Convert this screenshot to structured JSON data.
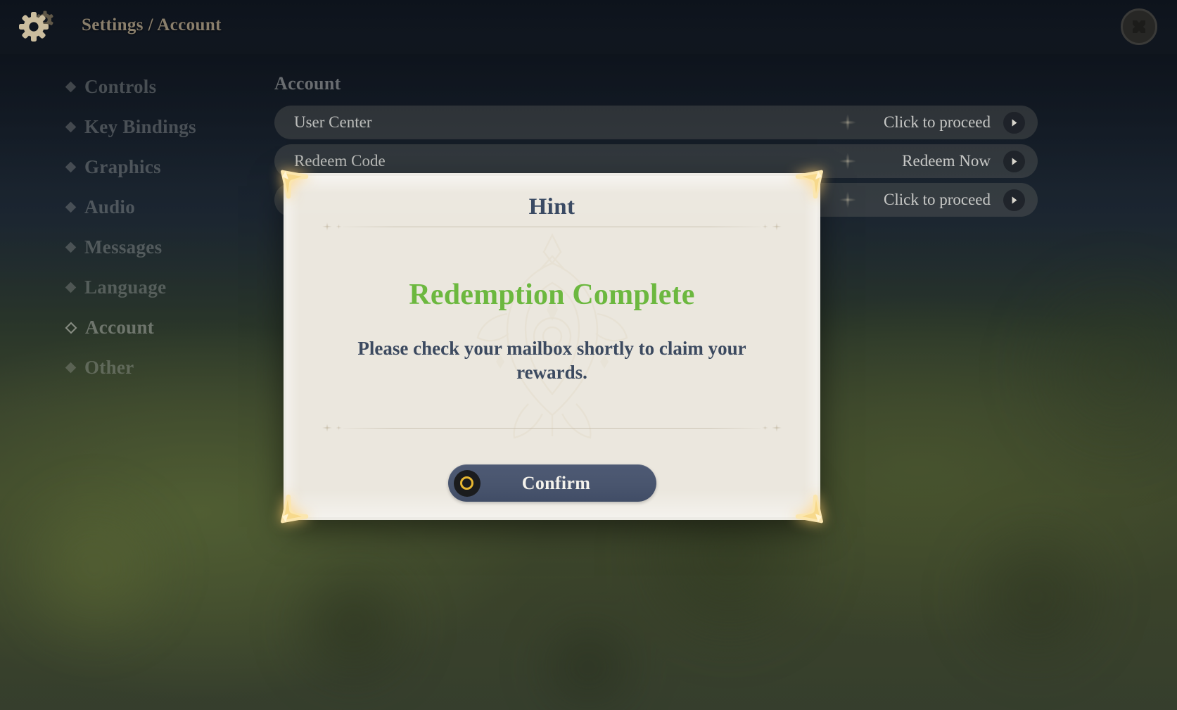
{
  "header": {
    "gear_icon": "gear-icon",
    "breadcrumb": "Settings / Account",
    "close_icon": "close-icon"
  },
  "sidebar": {
    "items": [
      {
        "label": "Controls",
        "active": false
      },
      {
        "label": "Key Bindings",
        "active": false
      },
      {
        "label": "Graphics",
        "active": false
      },
      {
        "label": "Audio",
        "active": false
      },
      {
        "label": "Messages",
        "active": false
      },
      {
        "label": "Language",
        "active": false
      },
      {
        "label": "Account",
        "active": true
      },
      {
        "label": "Other",
        "active": false
      }
    ]
  },
  "content": {
    "panel_title": "Account",
    "rows": [
      {
        "name": "User Center",
        "action": "Click to proceed",
        "arrow_icon": "chevron-right-icon"
      },
      {
        "name": "Redeem Code",
        "action": "Redeem Now",
        "arrow_icon": "chevron-right-icon"
      },
      {
        "name": "",
        "action": "Click to proceed",
        "arrow_icon": "chevron-right-icon"
      }
    ]
  },
  "modal": {
    "title": "Hint",
    "headline": "Redemption Complete",
    "message": "Please check your mailbox shortly to claim your rewards.",
    "confirm_label": "Confirm",
    "confirm_icon": "gold-ring-icon"
  },
  "colors": {
    "headline_green": "#6cb83f",
    "modal_text_navy": "#3c4a60",
    "modal_title_navy": "#3a4a63",
    "confirm_button": "#49556e",
    "gold_ornament": "#f6dfa0",
    "gold_ring": "#e8b731",
    "paper": "#ebe7de",
    "backdrop_olive": "#414c31"
  }
}
